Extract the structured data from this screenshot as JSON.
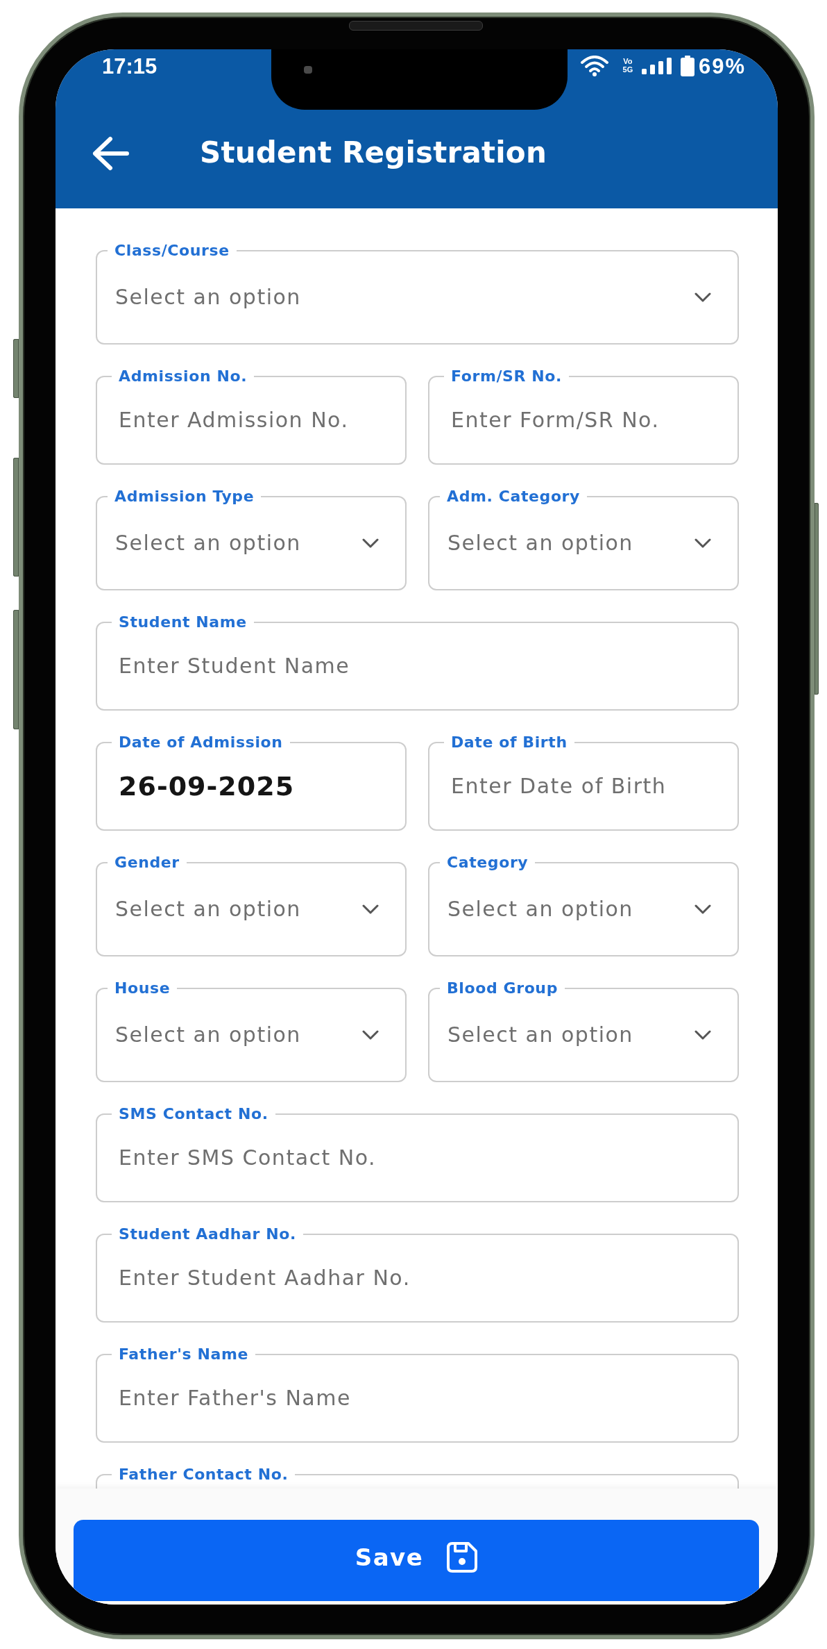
{
  "status_bar": {
    "time": "17:15",
    "network_type": "Vo 5G",
    "battery": "69%"
  },
  "header": {
    "title": "Student Registration"
  },
  "form": {
    "rows": [
      [
        {
          "kind": "select",
          "label": "Class/Course",
          "placeholder": "Select an option"
        }
      ],
      [
        {
          "kind": "text",
          "label": "Admission No.",
          "placeholder": "Enter Admission No."
        },
        {
          "kind": "text",
          "label": "Form/SR No.",
          "placeholder": "Enter Form/SR No."
        }
      ],
      [
        {
          "kind": "select",
          "label": "Admission Type",
          "placeholder": "Select an option"
        },
        {
          "kind": "select",
          "label": "Adm. Category",
          "placeholder": "Select an option"
        }
      ],
      [
        {
          "kind": "text",
          "label": "Student Name",
          "placeholder": "Enter Student Name"
        }
      ],
      [
        {
          "kind": "text",
          "label": "Date of Admission",
          "value": "26-09-2025"
        },
        {
          "kind": "text",
          "label": "Date of Birth",
          "placeholder": "Enter Date of Birth"
        }
      ],
      [
        {
          "kind": "select",
          "label": "Gender",
          "placeholder": "Select an option"
        },
        {
          "kind": "select",
          "label": "Category",
          "placeholder": "Select an option"
        }
      ],
      [
        {
          "kind": "select",
          "label": "House",
          "placeholder": "Select an option"
        },
        {
          "kind": "select",
          "label": "Blood Group",
          "placeholder": "Select an option"
        }
      ],
      [
        {
          "kind": "text",
          "label": "SMS Contact No.",
          "placeholder": "Enter SMS Contact No."
        }
      ],
      [
        {
          "kind": "text",
          "label": "Student Aadhar No.",
          "placeholder": "Enter Student Aadhar No."
        }
      ],
      [
        {
          "kind": "text",
          "label": "Father's Name",
          "placeholder": "Enter Father's Name"
        }
      ],
      [
        {
          "kind": "text",
          "label": "Father Contact No."
        }
      ]
    ]
  },
  "save_button": {
    "label": "Save"
  }
}
